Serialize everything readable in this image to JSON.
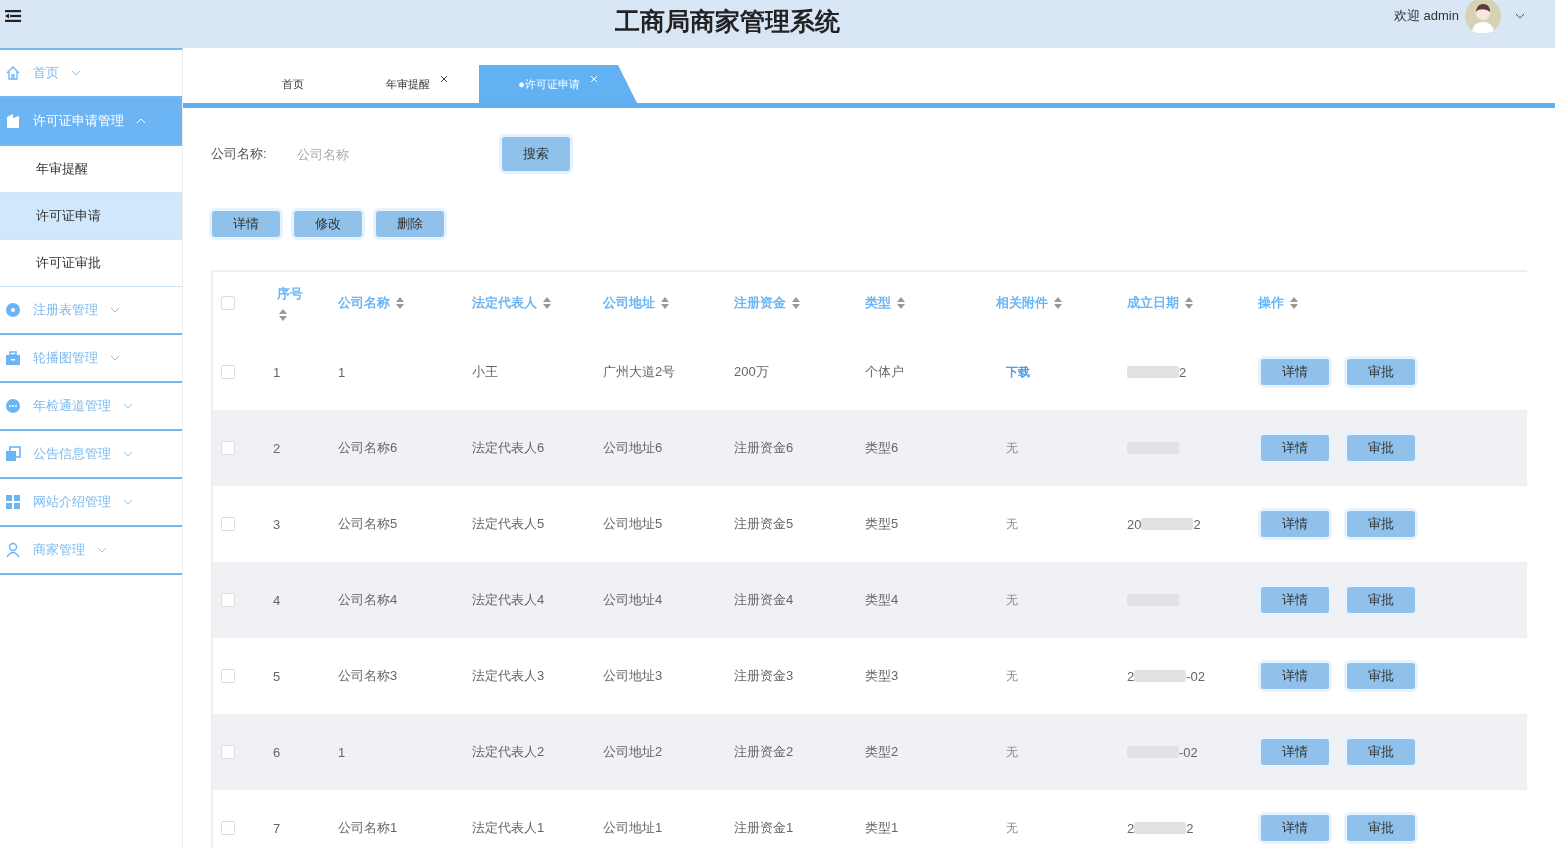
{
  "header": {
    "title": "工商局商家管理系统",
    "welcome": "欢迎 admin"
  },
  "sidebar": {
    "items": [
      {
        "label": "首页",
        "expanded": false,
        "selected": false
      },
      {
        "label": "许可证申请管理",
        "expanded": true,
        "selected": true,
        "children": [
          {
            "label": "年审提醒",
            "selected": false
          },
          {
            "label": "许可证申请",
            "selected": true
          },
          {
            "label": "许可证审批",
            "selected": false
          }
        ]
      },
      {
        "label": "注册表管理",
        "expanded": false,
        "selected": false
      },
      {
        "label": "轮播图管理",
        "expanded": false,
        "selected": false
      },
      {
        "label": "年检通道管理",
        "expanded": false,
        "selected": false
      },
      {
        "label": "公告信息管理",
        "expanded": false,
        "selected": false
      },
      {
        "label": "网站介绍管理",
        "expanded": false,
        "selected": false
      },
      {
        "label": "商家管理",
        "expanded": false,
        "selected": false
      }
    ]
  },
  "tabs": [
    {
      "label": "首页",
      "selected": false,
      "closable": false
    },
    {
      "label": "年审提醒",
      "selected": false,
      "closable": true
    },
    {
      "label": "●许可证申请",
      "selected": true,
      "closable": true
    }
  ],
  "search": {
    "label": "公司名称:",
    "placeholder": "公司名称",
    "button": "搜索"
  },
  "toolbar": [
    "详情",
    "修改",
    "删除"
  ],
  "table": {
    "header_checked": false,
    "columns": [
      "序号",
      "公司名称",
      "法定代表人",
      "公司地址",
      "注册资金",
      "类型",
      "相关附件",
      "成立日期",
      "操作"
    ],
    "rows": [
      {
        "checked": false,
        "no": "1",
        "company": "1",
        "rep": "小王",
        "address": "广州大道2号",
        "capital": "200万",
        "type": "个体户",
        "attachment": {
          "text": "下载",
          "kind": "link"
        },
        "date_end": "2",
        "actions": [
          "详情",
          "审批"
        ]
      },
      {
        "checked": false,
        "no": "2",
        "company": "公司名称6",
        "rep": "法定代表人6",
        "address": "公司地址6",
        "capital": "注册资金6",
        "type": "类型6",
        "attachment": {
          "text": "无",
          "kind": "none"
        },
        "actions": [
          "详情",
          "审批"
        ]
      },
      {
        "checked": false,
        "no": "3",
        "company": "公司名称5",
        "rep": "法定代表人5",
        "address": "公司地址5",
        "capital": "注册资金5",
        "type": "类型5",
        "attachment": {
          "text": "无",
          "kind": "none"
        },
        "date_start": "20",
        "date_end": "2",
        "actions": [
          "详情",
          "审批"
        ]
      },
      {
        "checked": false,
        "no": "4",
        "company": "公司名称4",
        "rep": "法定代表人4",
        "address": "公司地址4",
        "capital": "注册资金4",
        "type": "类型4",
        "attachment": {
          "text": "无",
          "kind": "none"
        },
        "actions": [
          "详情",
          "审批"
        ]
      },
      {
        "checked": false,
        "no": "5",
        "company": "公司名称3",
        "rep": "法定代表人3",
        "address": "公司地址3",
        "capital": "注册资金3",
        "type": "类型3",
        "attachment": {
          "text": "无",
          "kind": "none"
        },
        "date_start": "2",
        "date_end": "-02",
        "actions": [
          "详情",
          "审批"
        ]
      },
      {
        "checked": false,
        "no": "6",
        "company": "1",
        "rep": "法定代表人2",
        "address": "公司地址2",
        "capital": "注册资金2",
        "type": "类型2",
        "attachment": {
          "text": "无",
          "kind": "none"
        },
        "date_end": "-02",
        "actions": [
          "详情",
          "审批"
        ]
      },
      {
        "checked": false,
        "no": "7",
        "company": "公司名称1",
        "rep": "法定代表人1",
        "address": "公司地址1",
        "capital": "注册资金1",
        "type": "类型1",
        "attachment": {
          "text": "无",
          "kind": "none"
        },
        "date_start": "2",
        "date_end": "2",
        "actions": [
          "详情",
          "审批"
        ]
      }
    ]
  }
}
